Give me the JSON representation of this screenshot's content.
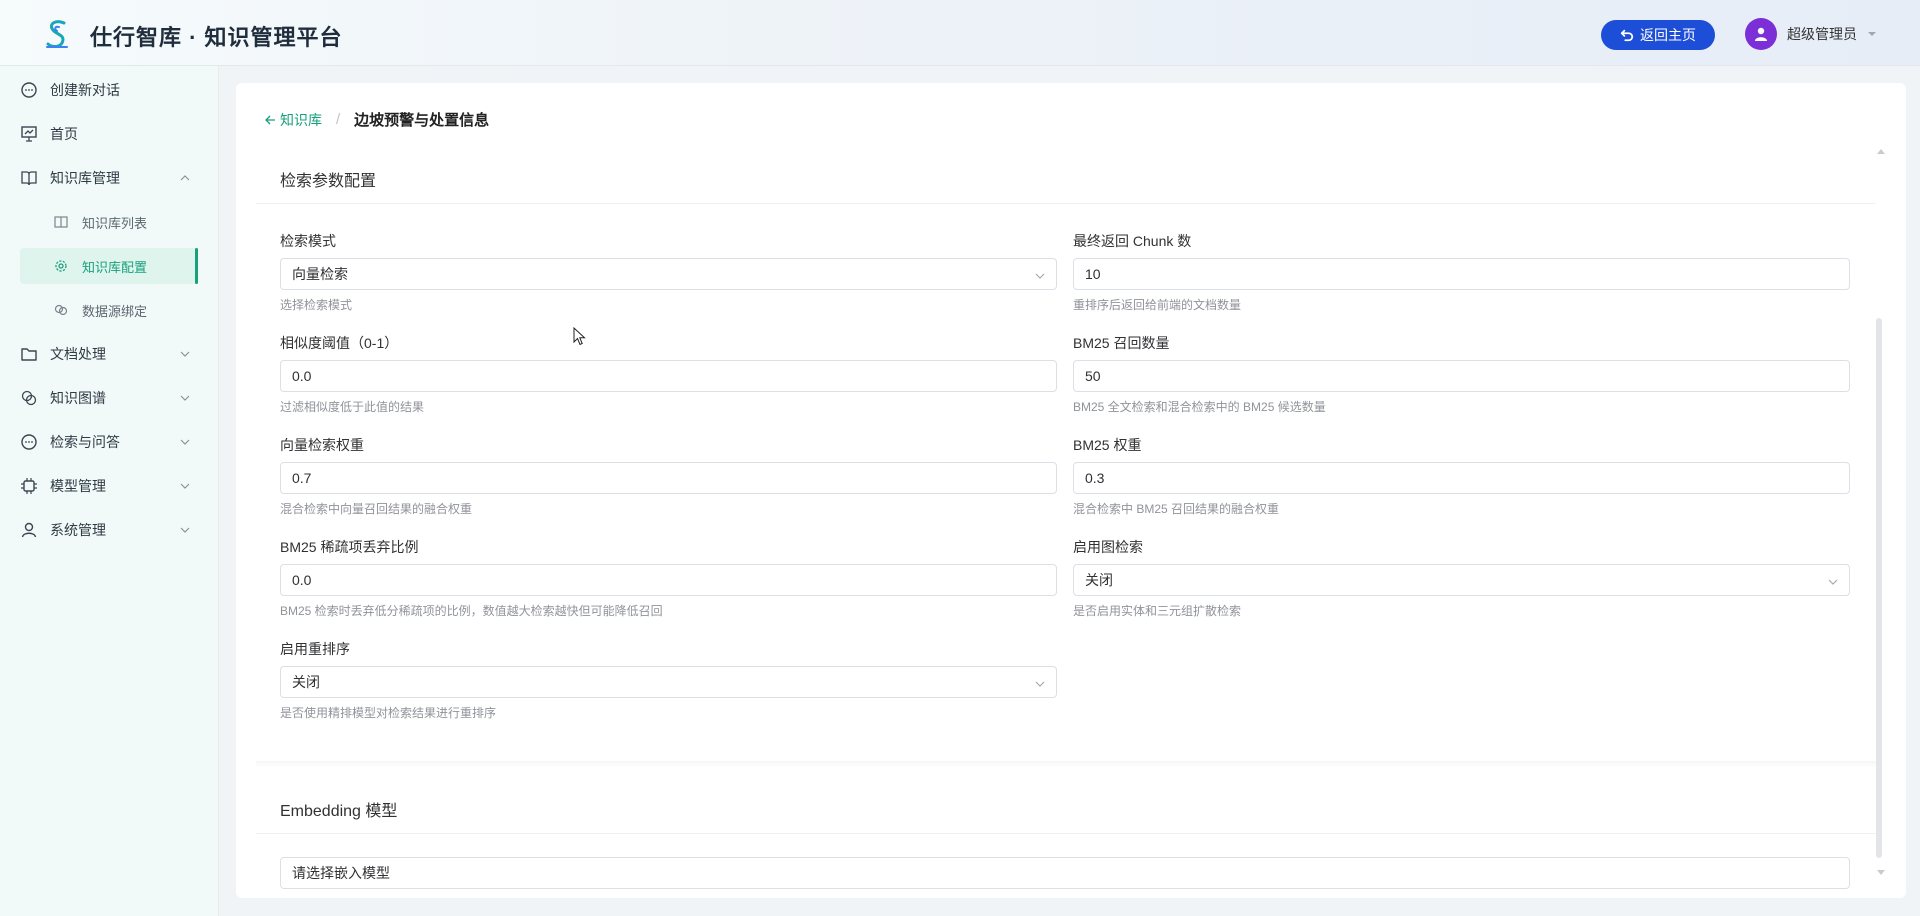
{
  "header": {
    "app_title": "仕行智库 · 知识管理平台",
    "home_button": "返回主页",
    "user_name": "超级管理员"
  },
  "sidebar": {
    "items": [
      {
        "label": "创建新对话",
        "icon": "chat-icon"
      },
      {
        "label": "首页",
        "icon": "presentation-icon"
      },
      {
        "label": "知识库管理",
        "icon": "book-icon",
        "expanded": true
      },
      {
        "label": "知识库列表",
        "icon": "book-icon"
      },
      {
        "label": "知识库配置",
        "icon": "gear-icon",
        "active": true
      },
      {
        "label": "数据源绑定",
        "icon": "link-icon"
      },
      {
        "label": "文档处理",
        "icon": "folder-icon"
      },
      {
        "label": "知识图谱",
        "icon": "graph-icon"
      },
      {
        "label": "检索与问答",
        "icon": "chat-icon"
      },
      {
        "label": "模型管理",
        "icon": "chip-icon"
      },
      {
        "label": "系统管理",
        "icon": "user-icon"
      }
    ]
  },
  "breadcrumb": {
    "back_label": "知识库",
    "separator": "/",
    "current": "边坡预警与处置信息"
  },
  "retrieval": {
    "title": "检索参数配置",
    "search_mode": {
      "label": "检索模式",
      "value": "向量检索",
      "hint": "选择检索模式"
    },
    "final_chunks": {
      "label": "最终返回 Chunk 数",
      "value": "10",
      "hint": "重排序后返回给前端的文档数量"
    },
    "similarity": {
      "label": "相似度阈值（0-1）",
      "value": "0.0",
      "hint": "过滤相似度低于此值的结果"
    },
    "bm25_recall": {
      "label": "BM25 召回数量",
      "value": "50",
      "hint": "BM25 全文检索和混合检索中的 BM25 候选数量"
    },
    "vector_weight": {
      "label": "向量检索权重",
      "value": "0.7",
      "hint": "混合检索中向量召回结果的融合权重"
    },
    "bm25_weight": {
      "label": "BM25 权重",
      "value": "0.3",
      "hint": "混合检索中 BM25 召回结果的融合权重"
    },
    "bm25_drop": {
      "label": "BM25 稀疏项丢弃比例",
      "value": "0.0",
      "hint": "BM25 检索时丢弃低分稀疏项的比例，数值越大检索越快但可能降低召回"
    },
    "graph_search": {
      "label": "启用图检索",
      "value": "关闭",
      "hint": "是否启用实体和三元组扩散检索"
    },
    "rerank": {
      "label": "启用重排序",
      "value": "关闭",
      "hint": "是否使用精排模型对检索结果进行重排序"
    }
  },
  "embedding": {
    "title": "Embedding 模型",
    "placeholder": "请选择嵌入模型"
  },
  "colors": {
    "accent": "#18a07c",
    "brand_button": "#1d4ed8",
    "avatar": "#7c2fd6"
  }
}
